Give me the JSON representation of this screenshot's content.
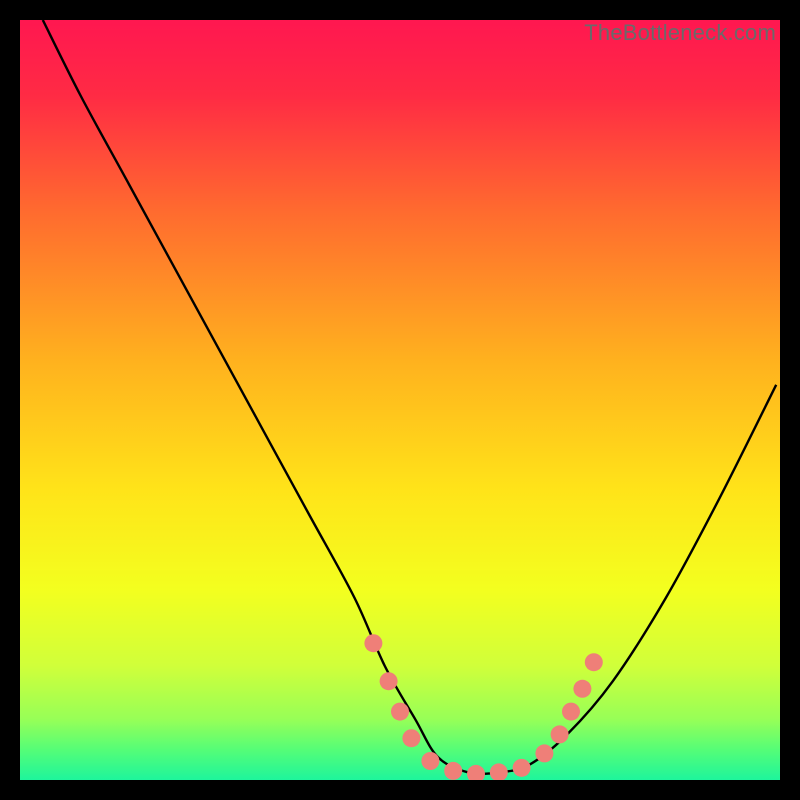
{
  "watermark": "TheBottleneck.com",
  "chart_data": {
    "type": "line",
    "title": "",
    "xlabel": "",
    "ylabel": "",
    "xlim": [
      0,
      100
    ],
    "ylim": [
      0,
      100
    ],
    "gradient_stops": [
      {
        "offset": 0,
        "color": "#ff1750"
      },
      {
        "offset": 10,
        "color": "#ff2b44"
      },
      {
        "offset": 25,
        "color": "#ff6a2f"
      },
      {
        "offset": 45,
        "color": "#ffb21e"
      },
      {
        "offset": 62,
        "color": "#ffe419"
      },
      {
        "offset": 75,
        "color": "#f3ff1f"
      },
      {
        "offset": 85,
        "color": "#d0ff3a"
      },
      {
        "offset": 92,
        "color": "#97ff57"
      },
      {
        "offset": 96,
        "color": "#55fd77"
      },
      {
        "offset": 100,
        "color": "#1ef59c"
      }
    ],
    "series": [
      {
        "name": "bottleneck-curve",
        "x": [
          3,
          8,
          14,
          20,
          26,
          32,
          38,
          44,
          48,
          52,
          55,
          59,
          63,
          67,
          72,
          78,
          85,
          92,
          99.5
        ],
        "y": [
          100,
          90,
          79,
          68,
          57,
          46,
          35,
          24,
          15,
          8,
          3,
          1,
          1,
          2,
          6,
          13,
          24,
          37,
          52
        ]
      }
    ],
    "markers": {
      "name": "highlight-dots",
      "color": "#ef7f78",
      "radius": 9,
      "points": [
        {
          "x": 46.5,
          "y": 18.0
        },
        {
          "x": 48.5,
          "y": 13.0
        },
        {
          "x": 50.0,
          "y": 9.0
        },
        {
          "x": 51.5,
          "y": 5.5
        },
        {
          "x": 54.0,
          "y": 2.5
        },
        {
          "x": 57.0,
          "y": 1.2
        },
        {
          "x": 60.0,
          "y": 0.8
        },
        {
          "x": 63.0,
          "y": 1.0
        },
        {
          "x": 66.0,
          "y": 1.6
        },
        {
          "x": 69.0,
          "y": 3.5
        },
        {
          "x": 71.0,
          "y": 6.0
        },
        {
          "x": 72.5,
          "y": 9.0
        },
        {
          "x": 74.0,
          "y": 12.0
        },
        {
          "x": 75.5,
          "y": 15.5
        }
      ]
    }
  }
}
